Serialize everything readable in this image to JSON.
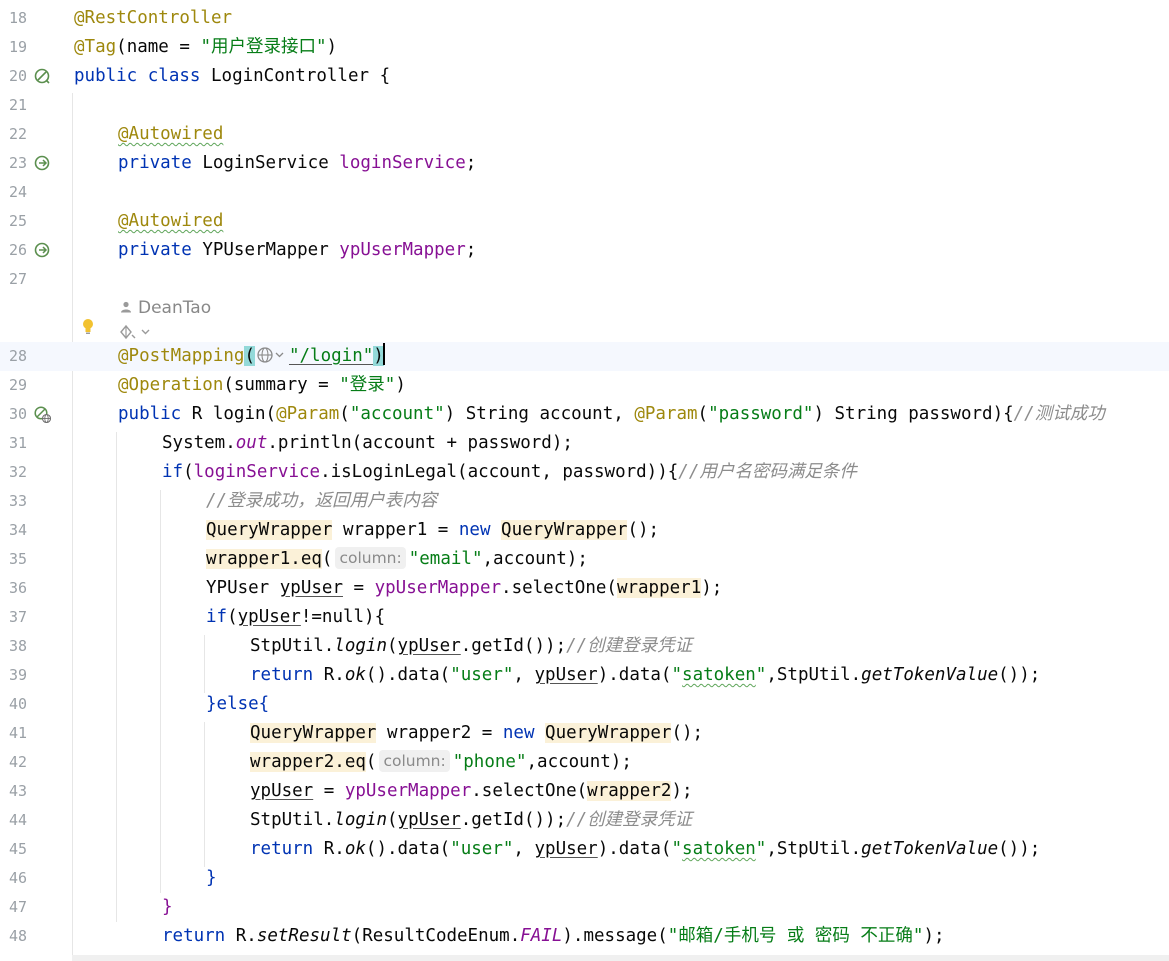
{
  "editor": {
    "lines": [
      {
        "num": "18"
      },
      {
        "num": "19"
      },
      {
        "num": "20"
      },
      {
        "num": "21"
      },
      {
        "num": "22"
      },
      {
        "num": "23"
      },
      {
        "num": "24"
      },
      {
        "num": "25"
      },
      {
        "num": "26"
      },
      {
        "num": "27"
      },
      {
        "num": "28"
      },
      {
        "num": "29"
      },
      {
        "num": "30"
      },
      {
        "num": "31"
      },
      {
        "num": "32"
      },
      {
        "num": "33"
      },
      {
        "num": "34"
      },
      {
        "num": "35"
      },
      {
        "num": "36"
      },
      {
        "num": "37"
      },
      {
        "num": "38"
      },
      {
        "num": "39"
      },
      {
        "num": "40"
      },
      {
        "num": "41"
      },
      {
        "num": "42"
      },
      {
        "num": "43"
      },
      {
        "num": "44"
      },
      {
        "num": "45"
      },
      {
        "num": "46"
      },
      {
        "num": "47"
      },
      {
        "num": "48"
      }
    ],
    "code_vision_author": "DeanTao",
    "hints": {
      "column": "column:"
    },
    "tokens": {
      "rest_controller": "@RestController",
      "tag_ann": "@Tag",
      "tag_open": "(name = ",
      "tag_name": "\"用户登录接口\"",
      "tag_close": ")",
      "public": "public",
      "class": "class",
      "class_name": "LoginController {",
      "autowired": "@Autowired",
      "private": "private",
      "login_service_type": "LoginService",
      "login_service_field": "loginService",
      "semicolon": ";",
      "ypusermapper_type": "YPUserMapper",
      "ypusermapper_field": "ypUserMapper",
      "post_mapping": "@PostMapping",
      "paren_open": "(",
      "paren_close": ")",
      "login_path": "\"/login\"",
      "operation": "@Operation",
      "summary_open": "(summary = ",
      "summary_val": "\"登录\"",
      "r_type": "R",
      "login_sig_a": "login(",
      "param_ann": "@Param",
      "account_str": "\"account\"",
      "string_account": ") String account, ",
      "password_str": "\"password\"",
      "string_password": ") String password){",
      "cmt_test_ok": "//测试成功",
      "system": "System.",
      "out": "out",
      "println": ".println(account + password);",
      "if": "if",
      "is_login_legal": ".isLoginLegal(account, password)){",
      "cmt_user_ok": "//用户名密码满足条件",
      "cmt_login_success": "//登录成功，返回用户表内容",
      "query_wrapper": "QueryWrapper",
      "wrapper1_decl": " wrapper1 = ",
      "new": "new",
      "ctor_end": "();",
      "wrapper1_eq": "wrapper1.eq",
      "email_str": "\"email\"",
      "account_end": ",account);",
      "ypuser_type": "YPUser ",
      "ypuser_var": "ypUser",
      "assign": " = ",
      "select_one": ".selectOne(",
      "wrapper1": "wrapper1",
      "select_end": ");",
      "if_open": "(",
      "not_null": "!=null){",
      "stputil": "StpUtil.",
      "login_m": "login",
      "get_id": ".getId());",
      "cmt_create_cred": "//创建登录凭证",
      "return": "return",
      "r_ok_a": " R.",
      "ok": "ok",
      "data_user_a": "().data(",
      "user_str": "\"user\"",
      "comma_sp": ", ",
      "data_close": ").data(",
      "satoken_q1": "\"",
      "satoken": "satoken",
      "satoken_q2": "\"",
      "stp_get": ",StpUtil.",
      "get_token": "getTokenValue",
      "tail": "());",
      "else": "}else{",
      "wrapper2_decl": " wrapper2 = ",
      "wrapper2_eq": "wrapper2.eq",
      "phone_str": "\"phone\"",
      "wrapper2": "wrapper2",
      "close_brace": "}",
      "r_dot": " R.",
      "set_result": "setResult",
      "result_code": "(ResultCodeEnum.",
      "fail": "FAIL",
      "message_open": ").message(",
      "fail_msg": "\"邮箱/手机号 或 密码 不正确\"",
      "brace_open": "{"
    }
  },
  "colors": {
    "keyword": "#0033b3",
    "annotation": "#9e880d",
    "string": "#067d17",
    "field": "#871094",
    "comment": "#8c8c8c",
    "current_line": "#f5f8fe"
  }
}
